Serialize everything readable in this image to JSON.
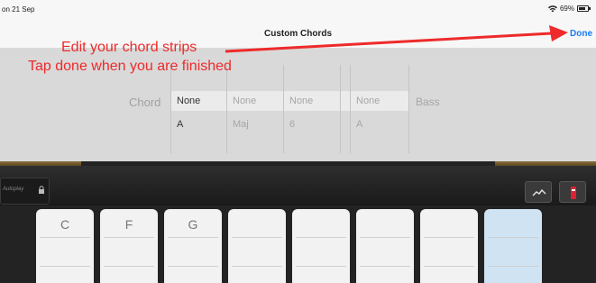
{
  "status": {
    "time": "on 21 Sep",
    "battery": "69%"
  },
  "nav": {
    "title": "Custom Chords",
    "done_label": "Done"
  },
  "annotation": {
    "line1": "Edit your chord strips",
    "line2": "Tap done when you are finished",
    "color": "#ee2a2a"
  },
  "chord_editor": {
    "chord_label": "Chord",
    "bass_label": "Bass",
    "row1": [
      "None",
      "None",
      "None",
      "None"
    ],
    "row2": [
      "A",
      "Maj",
      "6",
      "A"
    ]
  },
  "instrument": {
    "autoplay_label": "Autoplay",
    "strips": [
      {
        "label": "C"
      },
      {
        "label": "F"
      },
      {
        "label": "G"
      },
      {
        "label": ""
      },
      {
        "label": ""
      },
      {
        "label": ""
      },
      {
        "label": ""
      },
      {
        "label": ""
      }
    ],
    "selected_strip_color": "#cfe3f3"
  },
  "colors": {
    "accent": "#1a7cf5"
  }
}
